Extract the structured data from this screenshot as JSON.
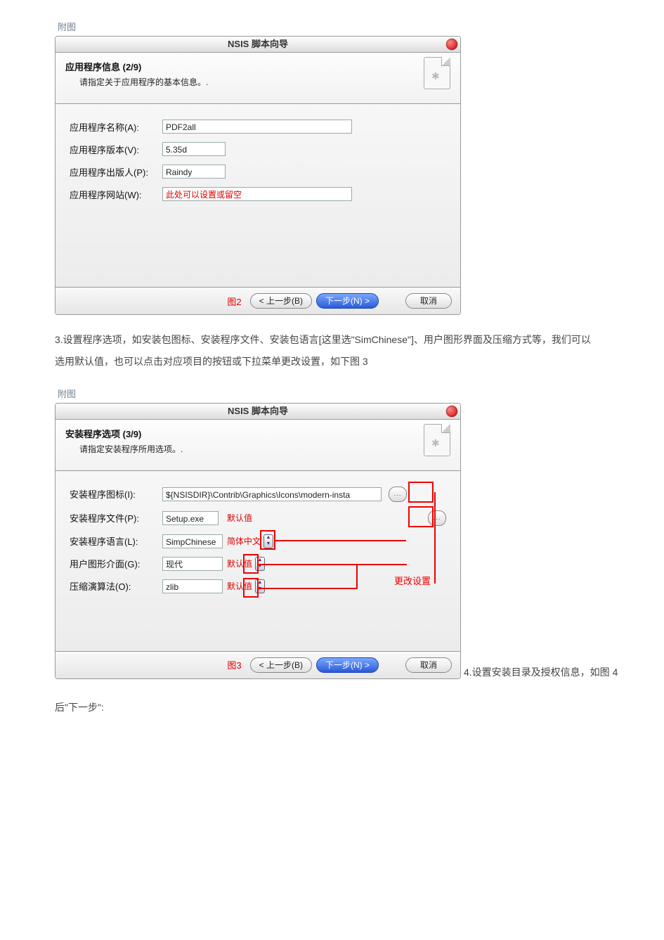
{
  "captions": {
    "fig": "附图"
  },
  "paragraphs": {
    "p3": "3.设置程序选项，如安装包图标、安装程序文件、安装包语言[这里选\"SimChinese\"]、用户图形界面及压缩方式等，我们可以选用默认值，也可以点击对应项目的按钮或下拉菜单更改设置，如下图 3",
    "p_after": "4.设置安装目录及授权信息，如图 4",
    "p_next": "后\"下一步\":"
  },
  "dialog1": {
    "title": "NSIS 脚本向导",
    "heading": "应用程序信息  (2/9)",
    "sub": "请指定关于应用程序的基本信息。.",
    "labels": {
      "name": "应用程序名称(A):",
      "ver": "应用程序版本(V):",
      "pub": "应用程序出版人(P):",
      "web": "应用程序网站(W):"
    },
    "values": {
      "name": "PDF2all",
      "ver": "5.35d",
      "pub": "Raindy",
      "web": "此处可以设置或留空"
    },
    "figlabel": "图2",
    "buttons": {
      "back": "< 上一步(B)",
      "next": "下一步(N) >",
      "cancel": "取消"
    }
  },
  "dialog2": {
    "title": "NSIS 脚本向导",
    "heading": "安装程序选项  (3/9)",
    "sub": "请指定安装程序所用选项。.",
    "labels": {
      "icon": "安装程序图标(I):",
      "file": "安装程序文件(P):",
      "lang": "安装程序语言(L):",
      "gui": "用户图形介面(G):",
      "comp": "压缩演算法(O):"
    },
    "values": {
      "icon": "${NSISDIR}\\Contrib\\Graphics\\Icons\\modern-insta",
      "file": "Setup.exe",
      "lang": "SimpChinese",
      "lang_note": "简体中文",
      "gui": "现代",
      "comp": "zlib"
    },
    "defaults_label": "默认值",
    "annot_label": "更改设置",
    "figlabel": "图3",
    "buttons": {
      "back": "< 上一步(B)",
      "next": "下一步(N) >",
      "cancel": "取消"
    }
  }
}
